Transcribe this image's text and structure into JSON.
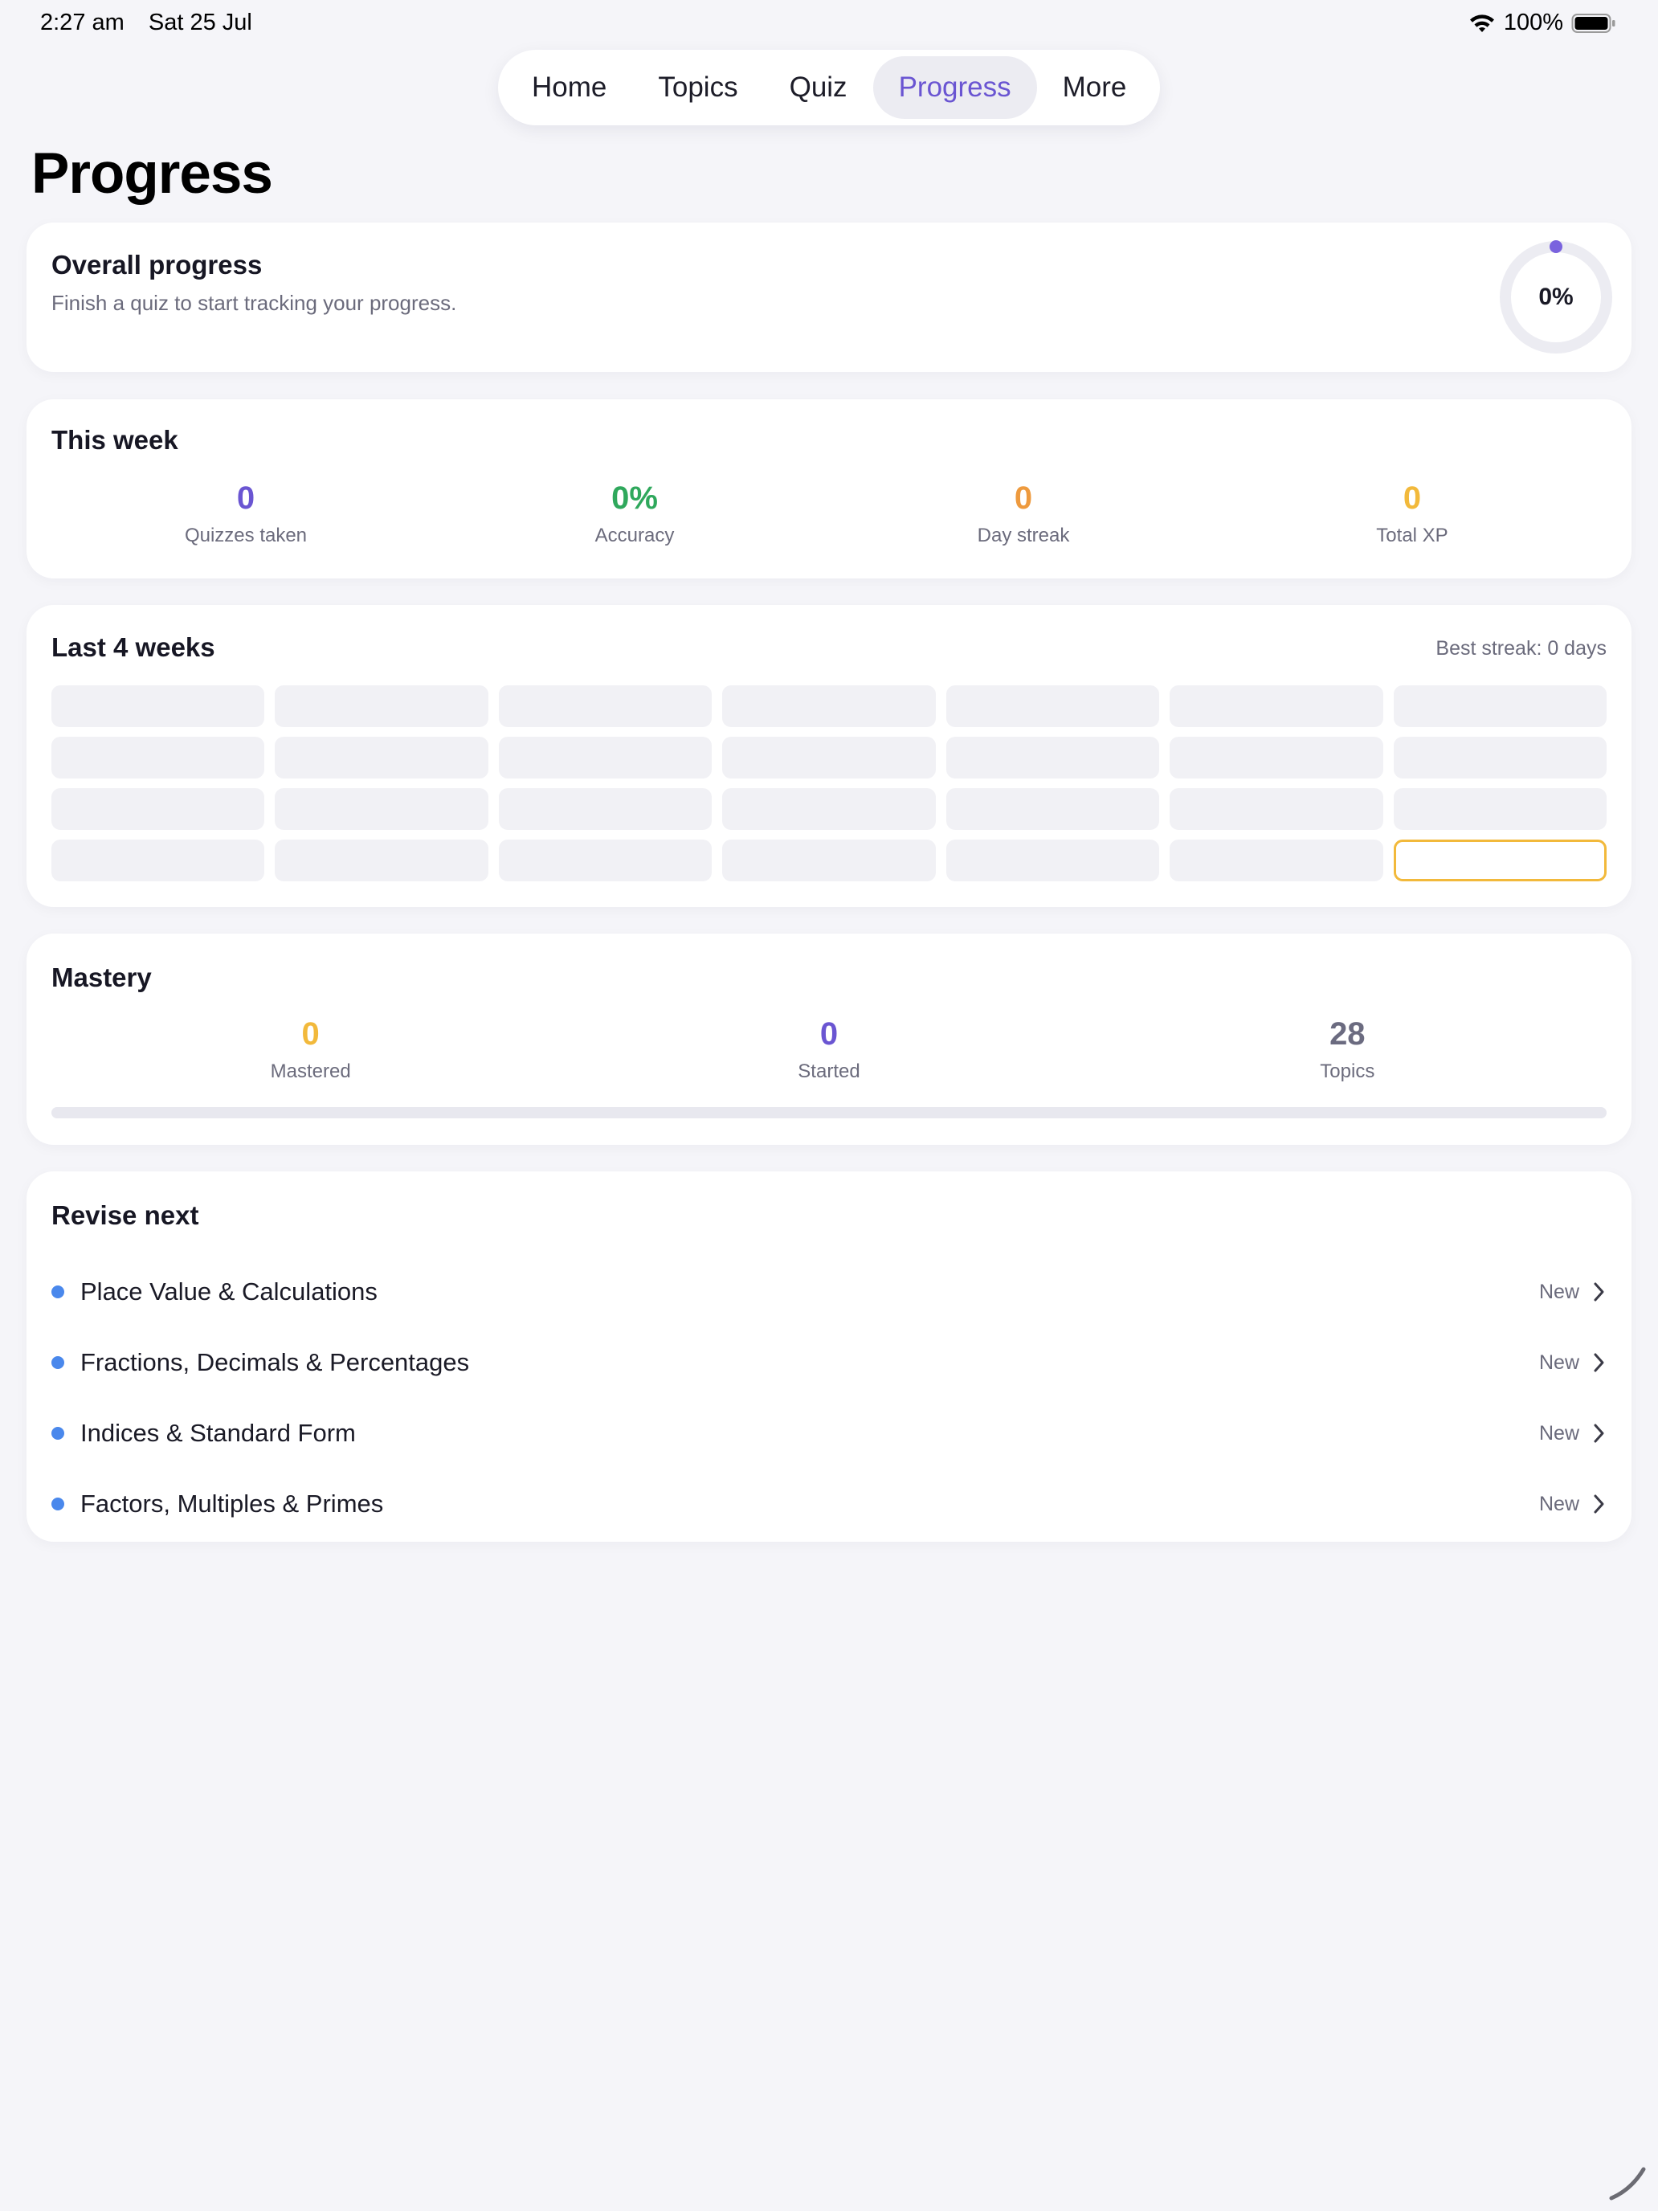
{
  "status_bar": {
    "time": "2:27 am",
    "date": "Sat 25 Jul",
    "battery": "100%",
    "icons": [
      "wifi-icon",
      "battery-icon"
    ]
  },
  "nav": {
    "items": [
      "Home",
      "Topics",
      "Quiz",
      "Progress",
      "More"
    ],
    "active": "Progress"
  },
  "page": {
    "title": "Progress"
  },
  "overall": {
    "title": "Overall progress",
    "subtitle": "Finish a quiz to start tracking your progress.",
    "percent_label": "0%",
    "percent_value": 0
  },
  "this_week": {
    "title": "This week",
    "stats": [
      {
        "value": "0",
        "label": "Quizzes taken",
        "color": "#6a55d2"
      },
      {
        "value": "0%",
        "label": "Accuracy",
        "color": "#2fa85c"
      },
      {
        "value": "0",
        "label": "Day streak",
        "color": "#ee9a3e"
      },
      {
        "value": "0",
        "label": "Total XP",
        "color": "#f2b93b"
      }
    ]
  },
  "last_4_weeks": {
    "title": "Last 4 weeks",
    "best_streak": "Best streak: 0 days",
    "weeks": 4,
    "days_per_week": 7,
    "today_index": 27
  },
  "mastery": {
    "title": "Mastery",
    "stats": [
      {
        "value": "0",
        "label": "Mastered",
        "color": "#f2b93b"
      },
      {
        "value": "0",
        "label": "Started",
        "color": "#6a55d2"
      },
      {
        "value": "28",
        "label": "Topics",
        "color": "#6b6b80"
      }
    ],
    "progress_fraction": 0
  },
  "revise_next": {
    "title": "Revise next",
    "items": [
      {
        "name": "Place Value & Calculations",
        "badge": "New"
      },
      {
        "name": "Fractions, Decimals & Percentages",
        "badge": "New"
      },
      {
        "name": "Indices & Standard Form",
        "badge": "New"
      },
      {
        "name": "Factors, Multiples & Primes",
        "badge": "New"
      }
    ]
  },
  "colors": {
    "accent": "#6a55d2",
    "ring_track": "#ececf2",
    "today_border": "#f2b93b",
    "bullet": "#4a88ec"
  }
}
